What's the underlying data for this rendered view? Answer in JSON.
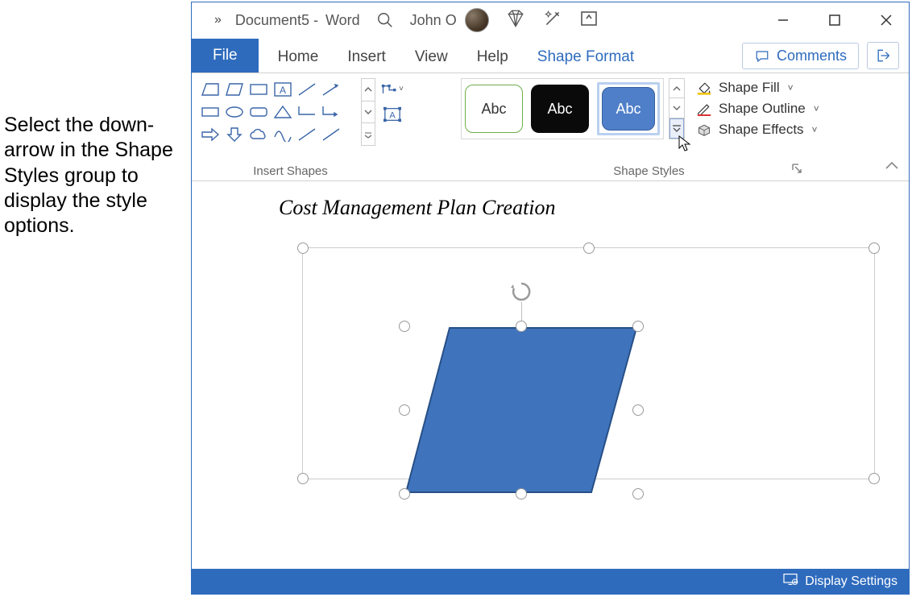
{
  "instruction_text": "Select the down-arrow in the Shape Styles group to display the style options.",
  "titlebar": {
    "overflow": "»",
    "doc_name": "Document5",
    "separator": " - ",
    "app_name": "Word",
    "user_name": "John O"
  },
  "tabs": {
    "file": "File",
    "home": "Home",
    "insert": "Insert",
    "view": "View",
    "help": "Help",
    "shape_format": "Shape Format"
  },
  "ribbon_right": {
    "comments": "Comments"
  },
  "groups": {
    "insert_shapes": "Insert Shapes",
    "shape_styles": "Shape Styles"
  },
  "style_cards": {
    "s1": "Abc",
    "s2": "Abc",
    "s3": "Abc"
  },
  "shape_tools": {
    "fill": "Shape Fill",
    "outline": "Shape Outline",
    "effects": "Shape Effects"
  },
  "document": {
    "heading": "Cost Management Plan Creation"
  },
  "statusbar": {
    "display_settings": "Display Settings"
  }
}
